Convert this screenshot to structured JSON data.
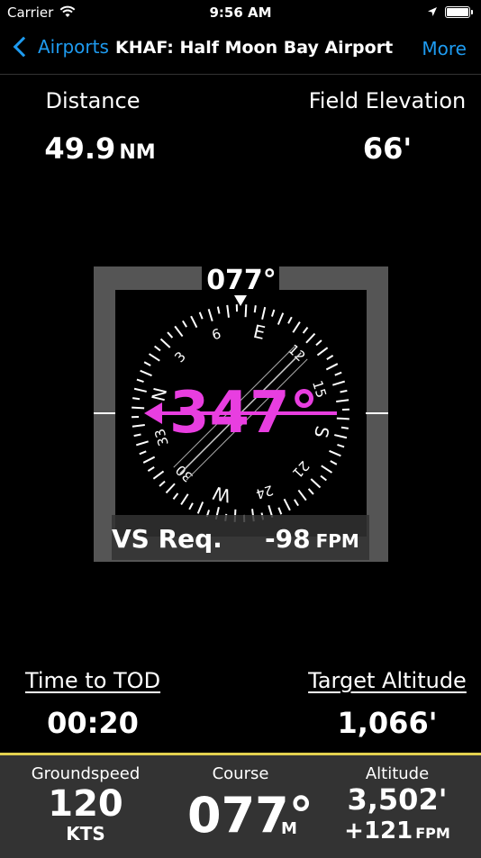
{
  "status_bar": {
    "carrier": "Carrier",
    "time": "9:56 AM"
  },
  "nav": {
    "back_label": "Airports",
    "title": "KHAF: Half Moon Bay Airport",
    "more_label": "More",
    "accent_color": "#1e9bf0"
  },
  "info": {
    "distance_label": "Distance",
    "distance_value": "49.9",
    "distance_unit": "NM",
    "elevation_label": "Field Elevation",
    "elevation_value": "66'"
  },
  "hsi": {
    "heading_readout": "077°",
    "bearing_readout": "347°",
    "vs_label": "VS Req.",
    "vs_value": "-98",
    "vs_unit": "FPM",
    "heading_deg": 77,
    "bearing_deg": 347,
    "compass_labels": [
      "N",
      "3",
      "6",
      "E",
      "12",
      "15",
      "S",
      "21",
      "24",
      "W",
      "30",
      "33"
    ],
    "bearing_color": "#e83ee0"
  },
  "descent": {
    "tod_label": "Time to TOD",
    "tod_value": "00:20",
    "target_alt_label": "Target Altitude",
    "target_alt_value": "1,066'"
  },
  "bottom": {
    "groundspeed_label": "Groundspeed",
    "groundspeed_value": "120",
    "groundspeed_unit": "KTS",
    "course_label": "Course",
    "course_value": "077°",
    "course_unit": "M",
    "altitude_label": "Altitude",
    "altitude_value": "3,502'",
    "vspeed_value": "+121",
    "vspeed_unit": "FPM",
    "accent_color": "#e2d14f"
  }
}
